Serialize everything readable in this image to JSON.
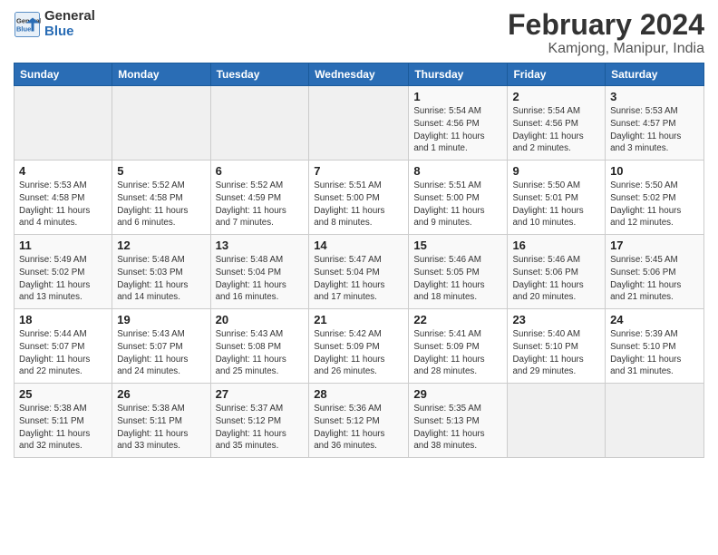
{
  "header": {
    "logo_line1": "General",
    "logo_line2": "Blue",
    "title": "February 2024",
    "subtitle": "Kamjong, Manipur, India"
  },
  "days_of_week": [
    "Sunday",
    "Monday",
    "Tuesday",
    "Wednesday",
    "Thursday",
    "Friday",
    "Saturday"
  ],
  "weeks": [
    [
      {
        "day": "",
        "info": ""
      },
      {
        "day": "",
        "info": ""
      },
      {
        "day": "",
        "info": ""
      },
      {
        "day": "",
        "info": ""
      },
      {
        "day": "1",
        "info": "Sunrise: 5:54 AM\nSunset: 4:56 PM\nDaylight: 11 hours\nand 1 minute."
      },
      {
        "day": "2",
        "info": "Sunrise: 5:54 AM\nSunset: 4:56 PM\nDaylight: 11 hours\nand 2 minutes."
      },
      {
        "day": "3",
        "info": "Sunrise: 5:53 AM\nSunset: 4:57 PM\nDaylight: 11 hours\nand 3 minutes."
      }
    ],
    [
      {
        "day": "4",
        "info": "Sunrise: 5:53 AM\nSunset: 4:58 PM\nDaylight: 11 hours\nand 4 minutes."
      },
      {
        "day": "5",
        "info": "Sunrise: 5:52 AM\nSunset: 4:58 PM\nDaylight: 11 hours\nand 6 minutes."
      },
      {
        "day": "6",
        "info": "Sunrise: 5:52 AM\nSunset: 4:59 PM\nDaylight: 11 hours\nand 7 minutes."
      },
      {
        "day": "7",
        "info": "Sunrise: 5:51 AM\nSunset: 5:00 PM\nDaylight: 11 hours\nand 8 minutes."
      },
      {
        "day": "8",
        "info": "Sunrise: 5:51 AM\nSunset: 5:00 PM\nDaylight: 11 hours\nand 9 minutes."
      },
      {
        "day": "9",
        "info": "Sunrise: 5:50 AM\nSunset: 5:01 PM\nDaylight: 11 hours\nand 10 minutes."
      },
      {
        "day": "10",
        "info": "Sunrise: 5:50 AM\nSunset: 5:02 PM\nDaylight: 11 hours\nand 12 minutes."
      }
    ],
    [
      {
        "day": "11",
        "info": "Sunrise: 5:49 AM\nSunset: 5:02 PM\nDaylight: 11 hours\nand 13 minutes."
      },
      {
        "day": "12",
        "info": "Sunrise: 5:48 AM\nSunset: 5:03 PM\nDaylight: 11 hours\nand 14 minutes."
      },
      {
        "day": "13",
        "info": "Sunrise: 5:48 AM\nSunset: 5:04 PM\nDaylight: 11 hours\nand 16 minutes."
      },
      {
        "day": "14",
        "info": "Sunrise: 5:47 AM\nSunset: 5:04 PM\nDaylight: 11 hours\nand 17 minutes."
      },
      {
        "day": "15",
        "info": "Sunrise: 5:46 AM\nSunset: 5:05 PM\nDaylight: 11 hours\nand 18 minutes."
      },
      {
        "day": "16",
        "info": "Sunrise: 5:46 AM\nSunset: 5:06 PM\nDaylight: 11 hours\nand 20 minutes."
      },
      {
        "day": "17",
        "info": "Sunrise: 5:45 AM\nSunset: 5:06 PM\nDaylight: 11 hours\nand 21 minutes."
      }
    ],
    [
      {
        "day": "18",
        "info": "Sunrise: 5:44 AM\nSunset: 5:07 PM\nDaylight: 11 hours\nand 22 minutes."
      },
      {
        "day": "19",
        "info": "Sunrise: 5:43 AM\nSunset: 5:07 PM\nDaylight: 11 hours\nand 24 minutes."
      },
      {
        "day": "20",
        "info": "Sunrise: 5:43 AM\nSunset: 5:08 PM\nDaylight: 11 hours\nand 25 minutes."
      },
      {
        "day": "21",
        "info": "Sunrise: 5:42 AM\nSunset: 5:09 PM\nDaylight: 11 hours\nand 26 minutes."
      },
      {
        "day": "22",
        "info": "Sunrise: 5:41 AM\nSunset: 5:09 PM\nDaylight: 11 hours\nand 28 minutes."
      },
      {
        "day": "23",
        "info": "Sunrise: 5:40 AM\nSunset: 5:10 PM\nDaylight: 11 hours\nand 29 minutes."
      },
      {
        "day": "24",
        "info": "Sunrise: 5:39 AM\nSunset: 5:10 PM\nDaylight: 11 hours\nand 31 minutes."
      }
    ],
    [
      {
        "day": "25",
        "info": "Sunrise: 5:38 AM\nSunset: 5:11 PM\nDaylight: 11 hours\nand 32 minutes."
      },
      {
        "day": "26",
        "info": "Sunrise: 5:38 AM\nSunset: 5:11 PM\nDaylight: 11 hours\nand 33 minutes."
      },
      {
        "day": "27",
        "info": "Sunrise: 5:37 AM\nSunset: 5:12 PM\nDaylight: 11 hours\nand 35 minutes."
      },
      {
        "day": "28",
        "info": "Sunrise: 5:36 AM\nSunset: 5:12 PM\nDaylight: 11 hours\nand 36 minutes."
      },
      {
        "day": "29",
        "info": "Sunrise: 5:35 AM\nSunset: 5:13 PM\nDaylight: 11 hours\nand 38 minutes."
      },
      {
        "day": "",
        "info": ""
      },
      {
        "day": "",
        "info": ""
      }
    ]
  ]
}
